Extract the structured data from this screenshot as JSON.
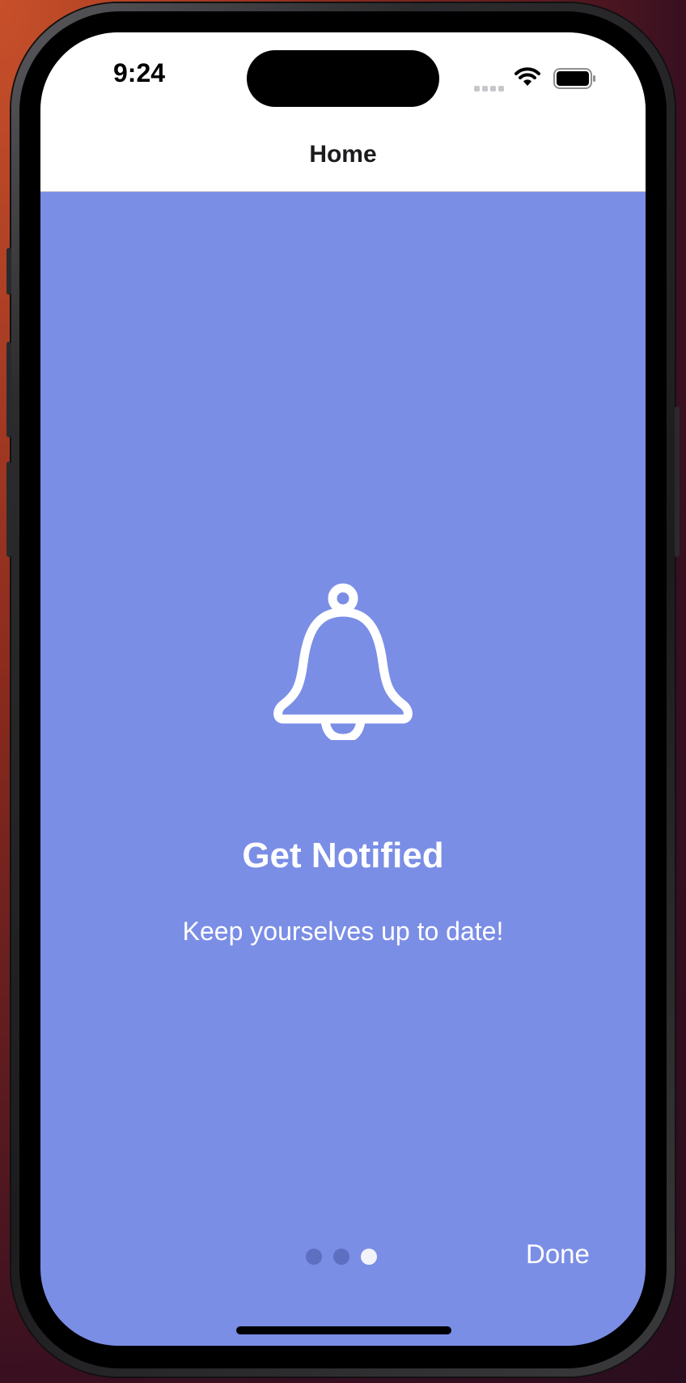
{
  "status_bar": {
    "time": "9:24",
    "icons": [
      "cellular-signal-icon",
      "wifi-icon",
      "battery-icon"
    ]
  },
  "nav": {
    "title": "Home"
  },
  "onboarding": {
    "icon": "bell-icon",
    "title": "Get Notified",
    "subtitle": "Keep yourselves up to date!",
    "page_count": 3,
    "current_page": 3,
    "done_label": "Done"
  },
  "colors": {
    "background": "#7b8ee6",
    "topbar": "#ffffff",
    "dot_inactive": "#5d6fc0",
    "dot_active": "#f2f3fb"
  }
}
